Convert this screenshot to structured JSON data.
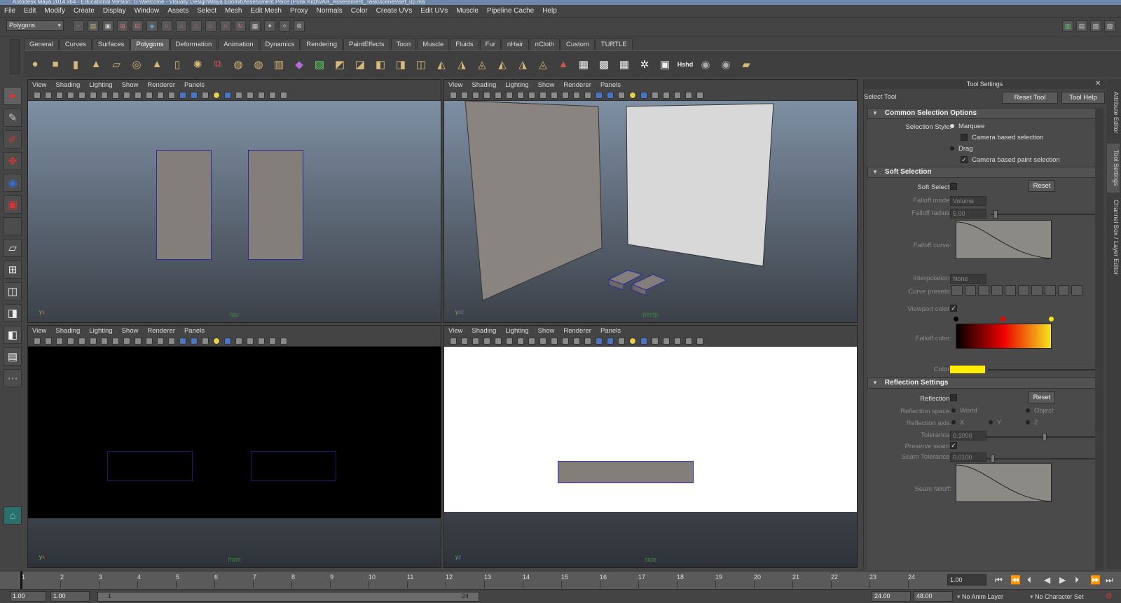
{
  "window": {
    "title": "Autodesk Maya 2014 x64 - Educational Version: G:\\Welcome - Visually Design\\Maya Edomit\\Assessment Peice (Punk Kid)\\VAA_Assessment_Task\\scenes\\set_up.ma"
  },
  "menu": [
    "File",
    "Edit",
    "Modify",
    "Create",
    "Display",
    "Window",
    "Assets",
    "Select",
    "Mesh",
    "Edit Mesh",
    "Proxy",
    "Normals",
    "Color",
    "Create UVs",
    "Edit UVs",
    "Muscle",
    "Pipeline Cache",
    "Help"
  ],
  "status_line": {
    "mode": "Polygons"
  },
  "shelf_tabs": [
    "General",
    "Curves",
    "Surfaces",
    "Polygons",
    "Deformation",
    "Animation",
    "Dynamics",
    "Rendering",
    "PaintEffects",
    "Toon",
    "Muscle",
    "Fluids",
    "Fur",
    "nHair",
    "nCloth",
    "Custom",
    "TURTLE"
  ],
  "shelf_active": "Polygons",
  "shelf_hshd": "Hshd",
  "panel_menu": [
    "View",
    "Shading",
    "Lighting",
    "Show",
    "Renderer",
    "Panels"
  ],
  "panels": {
    "top": "top",
    "persp": "persp",
    "front": "front",
    "side": "side"
  },
  "axes": {
    "x": "x",
    "y": "y",
    "z": "z"
  },
  "tool_settings": {
    "title": "Tool Settings",
    "tool_name": "Select Tool",
    "reset_tool": "Reset Tool",
    "tool_help": "Tool Help",
    "common": {
      "header": "Common Selection Options",
      "selection_style_label": "Selection Style:",
      "marquee": "Marquee",
      "camera_based_selection": "Camera based selection",
      "drag": "Drag",
      "camera_based_paint": "Camera based paint selection"
    },
    "soft": {
      "header": "Soft Selection",
      "soft_select_label": "Soft Select:",
      "reset": "Reset",
      "falloff_mode_label": "Falloff mode:",
      "falloff_mode_value": "Volume",
      "falloff_radius_label": "Falloff radius:",
      "falloff_radius_value": "5.00",
      "falloff_curve_label": "Falloff curve:",
      "interpolation_label": "Interpolation:",
      "interpolation_value": "None",
      "curve_presets_label": "Curve presets:",
      "viewport_color_label": "Viewport color:",
      "falloff_color_label": "Falloff color:",
      "color_label": "Color:",
      "color_value": "#ffee00",
      "gradient": [
        "#000000",
        "#ee0000",
        "#f4e41c"
      ]
    },
    "reflection": {
      "header": "Reflection Settings",
      "reflection_label": "Reflection:",
      "reset": "Reset",
      "space_label": "Reflection space:",
      "world": "World",
      "object": "Object",
      "axis_label": "Reflection axis:",
      "x": "X",
      "y": "Y",
      "z": "Z",
      "tolerance_label": "Tolerance:",
      "tolerance_value": "0.1000",
      "preserve_seam_label": "Preserve seam:",
      "seam_tolerance_label": "Seam Tolerance:",
      "seam_tolerance_value": "0.0100",
      "seam_falloff_label": "Seam falloff:"
    }
  },
  "right_tabs": [
    "Attribute Editor",
    "Tool Settings",
    "Channel Box / Layer Editor"
  ],
  "timeline": {
    "ticks": [
      "1",
      "2",
      "3",
      "4",
      "5",
      "6",
      "7",
      "8",
      "9",
      "10",
      "11",
      "12",
      "13",
      "14",
      "15",
      "16",
      "17",
      "18",
      "19",
      "20",
      "21",
      "22",
      "23",
      "24"
    ],
    "current": "1.00"
  },
  "range": {
    "start": "1.00",
    "start2": "1.00",
    "slider_start": "1",
    "slider_end": "24",
    "end": "24.00",
    "end2": "48.00",
    "anim_layer": "No Anim Layer",
    "character_set": "No Character Set"
  }
}
